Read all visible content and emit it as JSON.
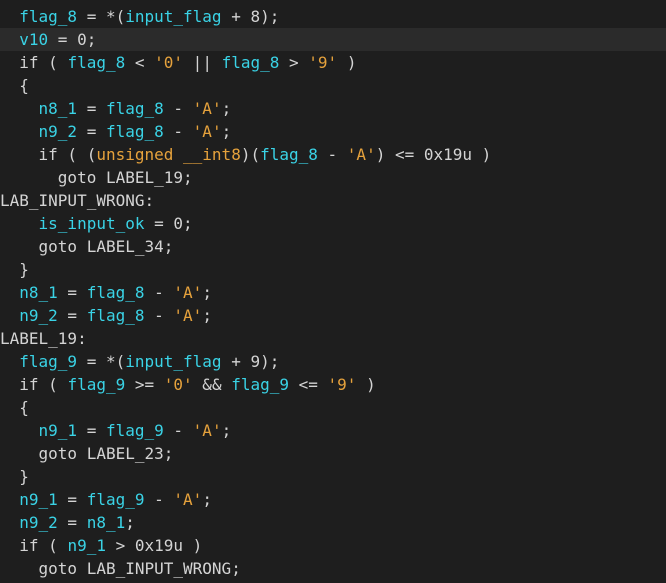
{
  "editor": {
    "highlight_color": "#2b2b2b",
    "colors": {
      "variable": "#3ad3e6",
      "string": "#e6a23c",
      "text": "#d4d4d4",
      "background": "#1e1e1e"
    },
    "lines": [
      [
        {
          "t": "  ",
          "c": "plain"
        },
        {
          "t": "flag_8",
          "c": "var"
        },
        {
          "t": " = *(",
          "c": "op"
        },
        {
          "t": "input_flag",
          "c": "var"
        },
        {
          "t": " + 8);",
          "c": "op"
        }
      ],
      [
        {
          "t": "  ",
          "c": "plain"
        },
        {
          "t": "v10",
          "c": "var"
        },
        {
          "t": " = 0;",
          "c": "op"
        }
      ],
      [
        {
          "t": "  if ( ",
          "c": "kw"
        },
        {
          "t": "flag_8",
          "c": "var"
        },
        {
          "t": " < ",
          "c": "op"
        },
        {
          "t": "'0'",
          "c": "str"
        },
        {
          "t": " || ",
          "c": "op"
        },
        {
          "t": "flag_8",
          "c": "var"
        },
        {
          "t": " > ",
          "c": "op"
        },
        {
          "t": "'9'",
          "c": "str"
        },
        {
          "t": " )",
          "c": "op"
        }
      ],
      [
        {
          "t": "  {",
          "c": "plain"
        }
      ],
      [
        {
          "t": "    ",
          "c": "plain"
        },
        {
          "t": "n8_1",
          "c": "var"
        },
        {
          "t": " = ",
          "c": "op"
        },
        {
          "t": "flag_8",
          "c": "var"
        },
        {
          "t": " - ",
          "c": "op"
        },
        {
          "t": "'A'",
          "c": "str"
        },
        {
          "t": ";",
          "c": "op"
        }
      ],
      [
        {
          "t": "    ",
          "c": "plain"
        },
        {
          "t": "n9_2",
          "c": "var"
        },
        {
          "t": " = ",
          "c": "op"
        },
        {
          "t": "flag_8",
          "c": "var"
        },
        {
          "t": " - ",
          "c": "op"
        },
        {
          "t": "'A'",
          "c": "str"
        },
        {
          "t": ";",
          "c": "op"
        }
      ],
      [
        {
          "t": "    if ( (",
          "c": "kw"
        },
        {
          "t": "unsigned __int8",
          "c": "type"
        },
        {
          "t": ")(",
          "c": "op"
        },
        {
          "t": "flag_8",
          "c": "var"
        },
        {
          "t": " - ",
          "c": "op"
        },
        {
          "t": "'A'",
          "c": "str"
        },
        {
          "t": ") <= 0x19u )",
          "c": "op"
        }
      ],
      [
        {
          "t": "      goto LABEL_19;",
          "c": "kw"
        }
      ],
      [
        {
          "t": "LAB_INPUT_WRONG:",
          "c": "lbl"
        }
      ],
      [
        {
          "t": "    ",
          "c": "plain"
        },
        {
          "t": "is_input_ok",
          "c": "var"
        },
        {
          "t": " = 0;",
          "c": "op"
        }
      ],
      [
        {
          "t": "    goto LABEL_34;",
          "c": "kw"
        }
      ],
      [
        {
          "t": "  }",
          "c": "plain"
        }
      ],
      [
        {
          "t": "  ",
          "c": "plain"
        },
        {
          "t": "n8_1",
          "c": "var"
        },
        {
          "t": " = ",
          "c": "op"
        },
        {
          "t": "flag_8",
          "c": "var"
        },
        {
          "t": " - ",
          "c": "op"
        },
        {
          "t": "'A'",
          "c": "str"
        },
        {
          "t": ";",
          "c": "op"
        }
      ],
      [
        {
          "t": "  ",
          "c": "plain"
        },
        {
          "t": "n9_2",
          "c": "var"
        },
        {
          "t": " = ",
          "c": "op"
        },
        {
          "t": "flag_8",
          "c": "var"
        },
        {
          "t": " - ",
          "c": "op"
        },
        {
          "t": "'A'",
          "c": "str"
        },
        {
          "t": ";",
          "c": "op"
        }
      ],
      [
        {
          "t": "LABEL_19:",
          "c": "lbl"
        }
      ],
      [
        {
          "t": "  ",
          "c": "plain"
        },
        {
          "t": "flag_9",
          "c": "var"
        },
        {
          "t": " = *(",
          "c": "op"
        },
        {
          "t": "input_flag",
          "c": "var"
        },
        {
          "t": " + 9);",
          "c": "op"
        }
      ],
      [
        {
          "t": "  if ( ",
          "c": "kw"
        },
        {
          "t": "flag_9",
          "c": "var"
        },
        {
          "t": " >= ",
          "c": "op"
        },
        {
          "t": "'0'",
          "c": "str"
        },
        {
          "t": " && ",
          "c": "op"
        },
        {
          "t": "flag_9",
          "c": "var"
        },
        {
          "t": " <= ",
          "c": "op"
        },
        {
          "t": "'9'",
          "c": "str"
        },
        {
          "t": " )",
          "c": "op"
        }
      ],
      [
        {
          "t": "  {",
          "c": "plain"
        }
      ],
      [
        {
          "t": "    ",
          "c": "plain"
        },
        {
          "t": "n9_1",
          "c": "var"
        },
        {
          "t": " = ",
          "c": "op"
        },
        {
          "t": "flag_9",
          "c": "var"
        },
        {
          "t": " - ",
          "c": "op"
        },
        {
          "t": "'A'",
          "c": "str"
        },
        {
          "t": ";",
          "c": "op"
        }
      ],
      [
        {
          "t": "    goto LABEL_23;",
          "c": "kw"
        }
      ],
      [
        {
          "t": "  }",
          "c": "plain"
        }
      ],
      [
        {
          "t": "  ",
          "c": "plain"
        },
        {
          "t": "n9_1",
          "c": "var"
        },
        {
          "t": " = ",
          "c": "op"
        },
        {
          "t": "flag_9",
          "c": "var"
        },
        {
          "t": " - ",
          "c": "op"
        },
        {
          "t": "'A'",
          "c": "str"
        },
        {
          "t": ";",
          "c": "op"
        }
      ],
      [
        {
          "t": "  ",
          "c": "plain"
        },
        {
          "t": "n9_2",
          "c": "var"
        },
        {
          "t": " = ",
          "c": "op"
        },
        {
          "t": "n8_1",
          "c": "var"
        },
        {
          "t": ";",
          "c": "op"
        }
      ],
      [
        {
          "t": "  if ( ",
          "c": "kw"
        },
        {
          "t": "n9_1",
          "c": "var"
        },
        {
          "t": " > 0x19u )",
          "c": "op"
        }
      ],
      [
        {
          "t": "    goto LAB_INPUT_WRONG;",
          "c": "kw"
        }
      ]
    ]
  }
}
